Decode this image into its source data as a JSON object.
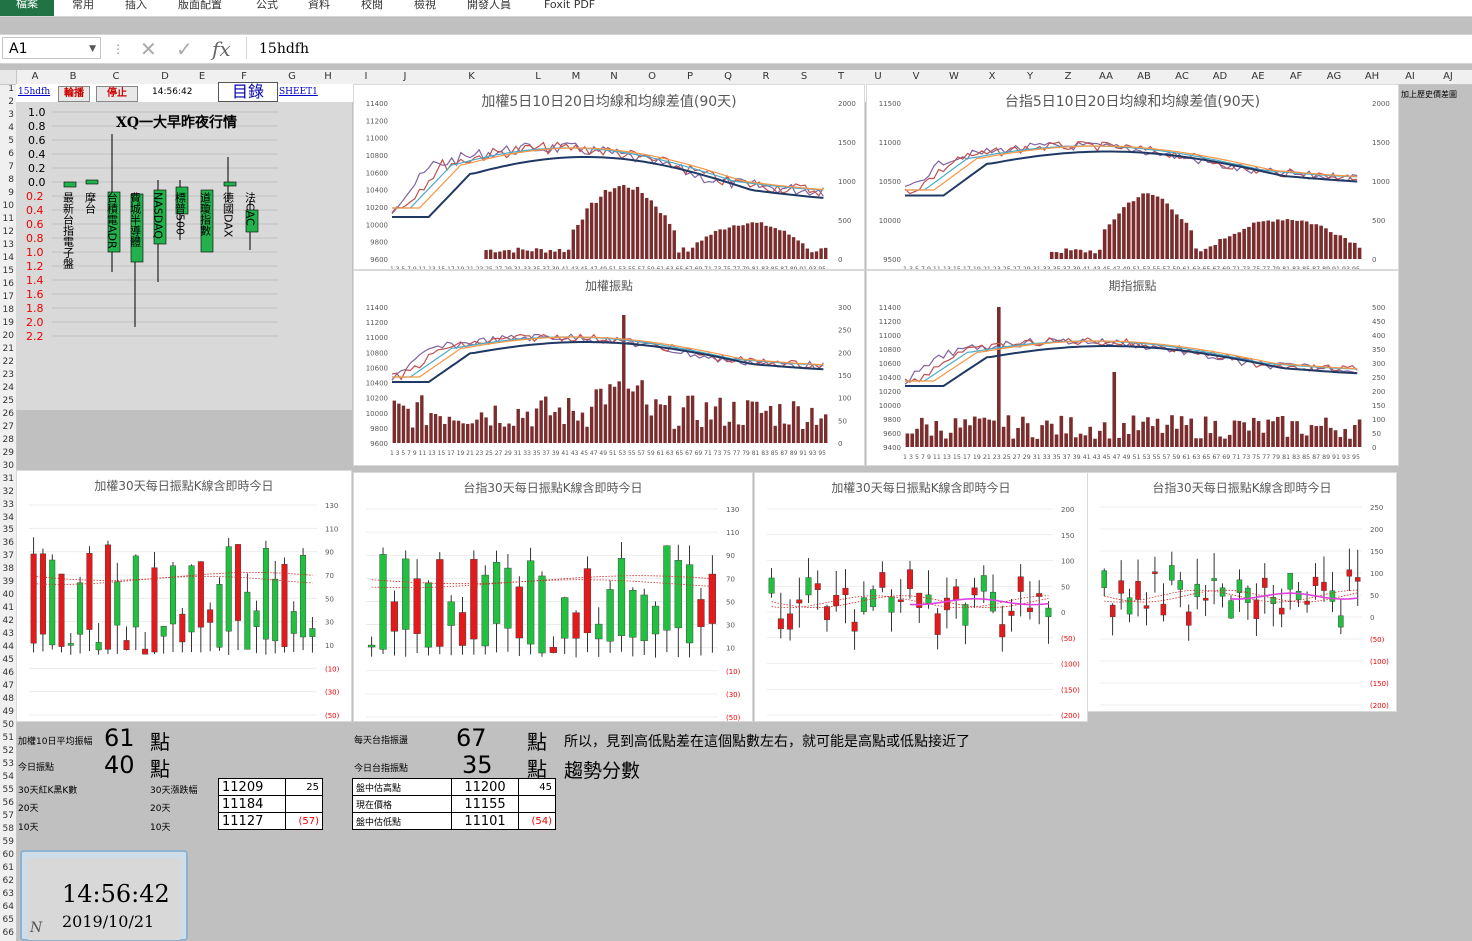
{
  "ribbon": {
    "file": "檔案",
    "tabs": [
      "常用",
      "插入",
      "版面配置",
      "公式",
      "資料",
      "校閱",
      "檢視",
      "開發人員",
      "Foxit PDF"
    ]
  },
  "formula_bar": {
    "cell_ref": "A1",
    "content": "15hdfh"
  },
  "columns": [
    "A",
    "B",
    "C",
    "D",
    "E",
    "F",
    "G",
    "H",
    "I",
    "J",
    "K",
    "L",
    "M",
    "N",
    "O",
    "P",
    "Q",
    "R",
    "S",
    "T",
    "U",
    "V",
    "W",
    "X",
    "Y",
    "Z",
    "AA",
    "AB",
    "AC",
    "AD",
    "AE",
    "AF",
    "AG",
    "AH",
    "AI",
    "AJ"
  ],
  "rows": [
    "1",
    "2",
    "3",
    "4",
    "5",
    "6",
    "7",
    "8",
    "9",
    "10",
    "11",
    "12",
    "13",
    "14",
    "15",
    "16",
    "17",
    "18",
    "19",
    "20",
    "21",
    "22",
    "23",
    "24",
    "25",
    "26",
    "27",
    "28",
    "29",
    "30",
    "31",
    "32",
    "33",
    "34",
    "35",
    "36",
    "37",
    "38",
    "39",
    "40",
    "41",
    "42",
    "43",
    "44",
    "45",
    "46",
    "47",
    "48",
    "49",
    "50",
    "51",
    "52",
    "53",
    "54",
    "55",
    "56",
    "57",
    "58",
    "59",
    "60",
    "61",
    "62",
    "63",
    "64",
    "65",
    "66"
  ],
  "row1": {
    "link1": "15hdfh",
    "btn_play": "輪播",
    "btn_stop": "停止",
    "time": "14:56:42",
    "toc": "目錄",
    "sheet_link": "SHEET1"
  },
  "side_note": "加上歷史價差圖",
  "xq_chart": {
    "title": "XQ一大早昨夜行情",
    "yticks_pos": [
      "1.0",
      "0.8",
      "0.6",
      "0.4",
      "0.2",
      "0.0"
    ],
    "yticks_neg": [
      "0.2",
      "0.4",
      "0.6",
      "0.8",
      "1.0",
      "1.2",
      "1.4",
      "1.6",
      "1.8",
      "2.0",
      "2.2"
    ],
    "labels": [
      "最新台指電子盤",
      "摩台",
      "台積電ADR",
      "費城半導體",
      "NASDAQ",
      "標普500",
      "道瓊指數",
      "德國DAX",
      "法CAC"
    ]
  },
  "chart_titles": {
    "twse_ma": "加權5日10日20日均線和均線差值(90天)",
    "tx_ma": "台指5日10日20日均線和均線差值(90天)",
    "twse_range": "加權振點",
    "tx_range": "期指振點",
    "k1": "加權30天每日振點K線含即時今日",
    "k2": "台指30天每日振點K線含即時今日",
    "k3": "加權30天每日振點K線含即時今日",
    "k4": "台指30天每日振點K線含即時今日"
  },
  "axes": {
    "twse_ma_left": [
      "11400",
      "11200",
      "11000",
      "10800",
      "10600",
      "10400",
      "10200",
      "10000",
      "9800",
      "9600"
    ],
    "twse_ma_right": [
      "2000",
      "1500",
      "1000",
      "500",
      "0"
    ],
    "tx_ma_left": [
      "11500",
      "11000",
      "10500",
      "10000",
      "9500"
    ],
    "tx_ma_right": [
      "2000",
      "1500",
      "1000",
      "500",
      "0"
    ],
    "twse_range_left": [
      "11400",
      "11200",
      "11000",
      "10800",
      "10600",
      "10400",
      "10200",
      "10000",
      "9800",
      "9600"
    ],
    "twse_range_right": [
      "300",
      "250",
      "200",
      "150",
      "100",
      "50",
      "0"
    ],
    "tx_range_left": [
      "11400",
      "11200",
      "11000",
      "10800",
      "10600",
      "10400",
      "10200",
      "10000",
      "9800",
      "9600",
      "9400"
    ],
    "tx_range_right": [
      "500",
      "450",
      "400",
      "350",
      "300",
      "250",
      "200",
      "150",
      "100",
      "50",
      "0"
    ],
    "k_ab": [
      "130",
      "110",
      "90",
      "70",
      "50",
      "30",
      "10",
      "(10)",
      "(30)",
      "(50)"
    ],
    "k_c": [
      "200",
      "150",
      "100",
      "50",
      "0",
      "(50)",
      "(100)",
      "(150)",
      "(200)"
    ],
    "k_d": [
      "250",
      "200",
      "150",
      "100",
      "50",
      "0",
      "(50)",
      "(100)",
      "(150)",
      "(200)"
    ],
    "x_odd": "1 3 5 7 9 11 13 15 17 19 21 23 25 27 29 31 33 35 37 39 41 43 45 47 49 51 53 55 57 59 61 63 65 67 69 71 73 75 77 79 81 83 85 87 89 91 93 95"
  },
  "stats": {
    "avg10_label": "加權10日平均振幅",
    "avg10_value": "61",
    "today_label": "今日振點",
    "today_value": "40",
    "unit": "點",
    "tx_daily_label": "每天台指振盪",
    "tx_daily_value": "67",
    "tx_today_label": "今日台指振點",
    "tx_today_value": "35",
    "note1": "所以，見到高低點差在這個點數左右，就可能是高點或低點接近了",
    "note2": "趨勢分數",
    "left_rows": [
      {
        "a": "30天紅K黑K數",
        "b": "30天漲跌幅",
        "v": "11209",
        "d": "25"
      },
      {
        "a": "20天",
        "b": "20天",
        "v": "11184",
        "d": ""
      },
      {
        "a": "10天",
        "b": "10天",
        "v": "11127",
        "d": "(57)"
      }
    ],
    "right_rows": [
      {
        "a": "盤中估高點",
        "v": "11200",
        "d": "45"
      },
      {
        "a": "現在價格",
        "v": "11155",
        "d": ""
      },
      {
        "a": "盤中估低點",
        "v": "11101",
        "d": "(54)"
      }
    ]
  },
  "clock": {
    "time": "14:56:42",
    "date": "2019/10/21",
    "mark": "N"
  },
  "colors": {
    "bar": "#7b2c2c",
    "ma5": "#8064a2",
    "ma10": "#4bacc6",
    "ma20": "#f79646",
    "ma60": "#1f3864",
    "red": "#e31a1c",
    "green": "#22c040",
    "excel": "#217346"
  }
}
